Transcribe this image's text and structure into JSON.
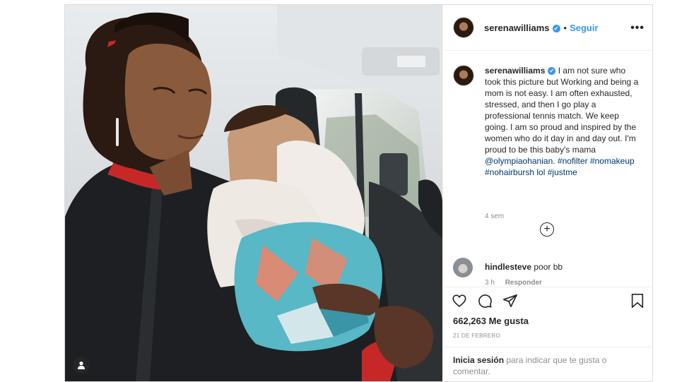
{
  "post": {
    "username": "serenawilliams",
    "verified_mark": "✔",
    "separator": "•",
    "follow_label": "Seguir",
    "more_icon": "more-horizontal-icon",
    "more_label": "•••"
  },
  "caption": {
    "username": "serenawilliams",
    "text": "I am not sure who took this picture but Working and being a mom is not easy. I am often exhausted, stressed, and then I go play a professional tennis match. We keep going. I am so proud and inspired by the women who do it day in and day out. I'm proud to be this baby's mama",
    "mention": "@olympiaohanian.",
    "hashtags": "#nofilter #nomakeup #nohairbursh lol #justme",
    "time": "4 sem"
  },
  "load_more_label": "+",
  "comment": {
    "username": "hindlesteve",
    "text": "poor bb",
    "time": "3 h",
    "reply_label": "Responder"
  },
  "actions": {
    "icons": [
      "heart-icon",
      "comment-icon",
      "share-icon",
      "bookmark-icon"
    ],
    "likes": "662,263 Me gusta",
    "date": "21 DE FEBRERO"
  },
  "login": {
    "link_label": "Inicia sesión",
    "rest_text": "para indicar que te gusta o comentar."
  },
  "colors": {
    "accent": "#3897f0",
    "text": "#262626",
    "muted": "#8e8e8e",
    "border": "#dbdbdb"
  }
}
